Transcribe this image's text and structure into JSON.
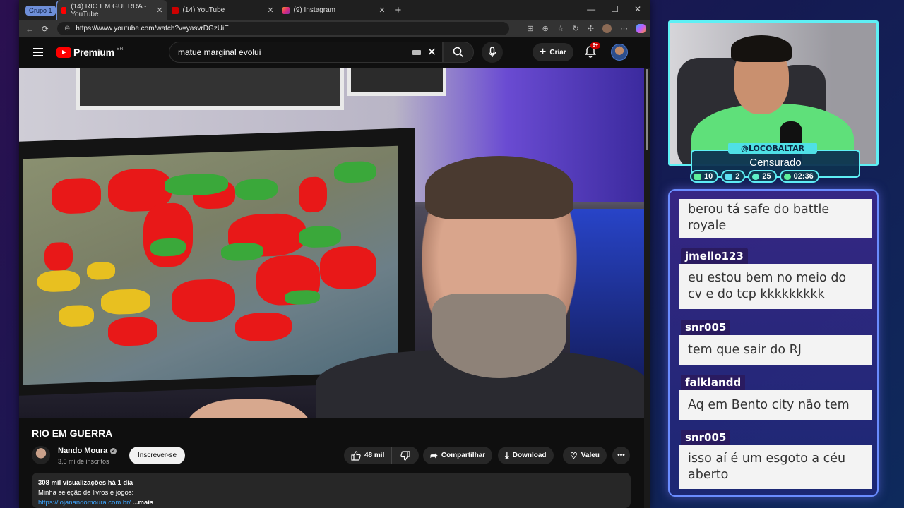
{
  "browser": {
    "tab_group": "Grupo 1",
    "tabs": [
      {
        "title": "(14) RIO EM GUERRA - YouTube",
        "active": true,
        "favicon_color": "#ff0000"
      },
      {
        "title": "(14) YouTube",
        "active": false,
        "favicon_color": "#ff0000"
      },
      {
        "title": "(9) Instagram",
        "active": false,
        "favicon_color": "#e1306c"
      }
    ],
    "url": "https://www.youtube.com/watch?v=yasvrDGzUiE"
  },
  "youtube": {
    "logo_text": "Premium",
    "country_code": "BR",
    "search_value": "matue marginal evolui",
    "create_label": "Criar",
    "notification_badge": "9+",
    "video": {
      "title": "RIO EM GUERRA",
      "channel_name": "Nando Moura",
      "subscribers": "3,5 mi de inscritos",
      "subscribe_label": "Inscrever-se",
      "likes": "48 mil",
      "share_label": "Compartilhar",
      "download_label": "Download",
      "thanks_label": "Valeu",
      "views_line": "308 mil visualizações  há 1 dia",
      "description_line": "Minha seleção de livros e jogos:",
      "description_link": "https://lojanandomoura.com.br/",
      "more_label": "...mais"
    }
  },
  "overlay": {
    "handle": "@LOCOBALTAR",
    "status": "Censurado",
    "counters": [
      "10",
      "2",
      "25",
      "02:36"
    ],
    "accent_color": "#5ef0f5",
    "chat": [
      {
        "user": "",
        "text_lines": [
          "berou tá safe do battle",
          "royale"
        ]
      },
      {
        "user": "jmello123",
        "text_lines": [
          "eu estou bem no meio do",
          "cv e do tcp kkkkkkkkk"
        ]
      },
      {
        "user": "snr005",
        "text_lines": [
          "tem que sair do RJ"
        ]
      },
      {
        "user": "falklandd",
        "text_lines": [
          "Aq em Bento city não tem"
        ]
      },
      {
        "user": "snr005",
        "text_lines": [
          "isso aí é um esgoto a céu",
          "aberto"
        ]
      }
    ]
  }
}
